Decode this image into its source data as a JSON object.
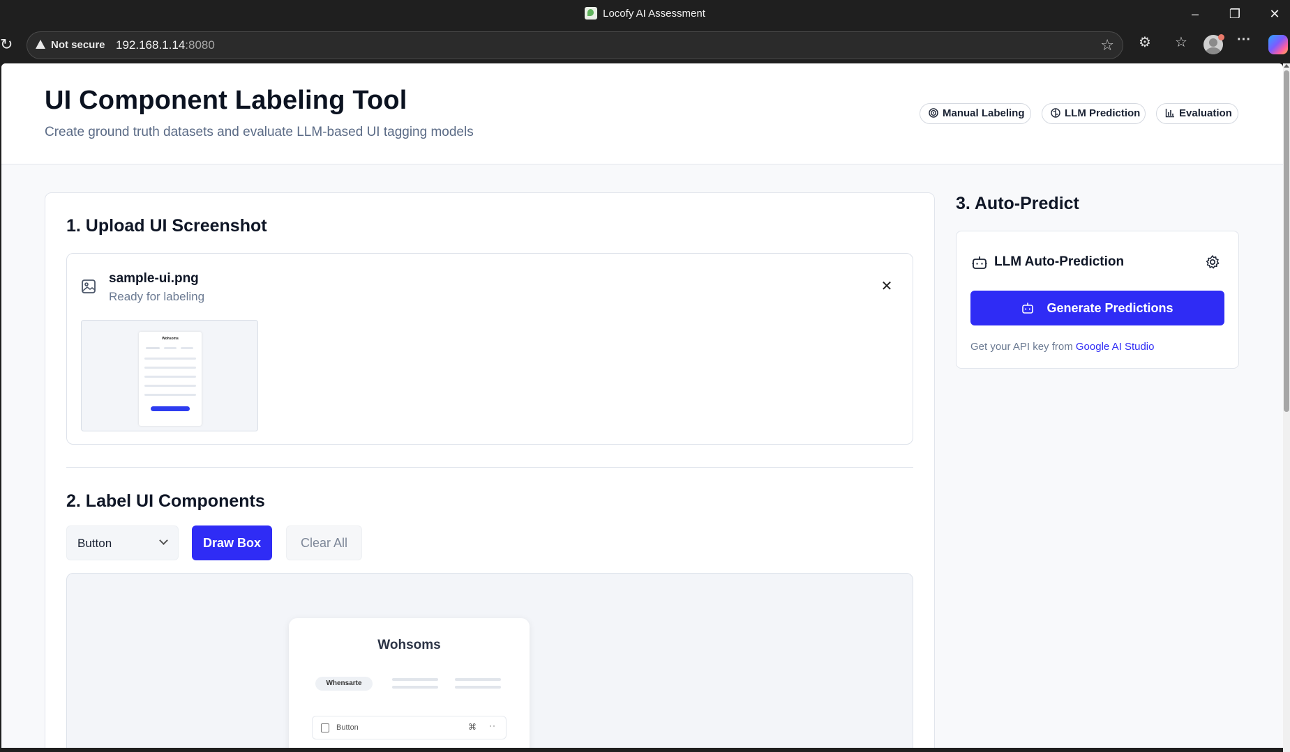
{
  "window": {
    "title": "Locofy AI Assessment"
  },
  "browser": {
    "security_label": "Not secure",
    "url_host": "192.168.1.14",
    "url_port": ":8080"
  },
  "header": {
    "title": "UI Component Labeling Tool",
    "subtitle": "Create ground truth datasets and evaluate LLM-based UI tagging models",
    "modes": [
      {
        "label": "Manual Labeling",
        "icon": "target-icon"
      },
      {
        "label": "LLM Prediction",
        "icon": "brain-icon"
      },
      {
        "label": "Evaluation",
        "icon": "bar-chart-icon"
      }
    ]
  },
  "upload": {
    "section_title": "1. Upload UI Screenshot",
    "file_name": "sample-ui.png",
    "file_status": "Ready for labeling",
    "preview_title": "Wohsoms"
  },
  "label": {
    "section_title": "2. Label UI Components",
    "component_type_selected": "Button",
    "draw_box_label": "Draw Box",
    "clear_all_label": "Clear All",
    "preview": {
      "title": "Wohsoms",
      "tab_label": "Whensarte",
      "row_label": "Button"
    }
  },
  "predict": {
    "section_title": "3. Auto-Predict",
    "card_title": "LLM Auto-Prediction",
    "generate_label": "Generate Predictions",
    "api_note_prefix": "Get your API key from",
    "api_link_label": "Google AI Studio"
  },
  "colors": {
    "accent": "#2f2cf5",
    "page_bg": "#f8f9fb",
    "chrome_bg": "#1f1f1f"
  }
}
